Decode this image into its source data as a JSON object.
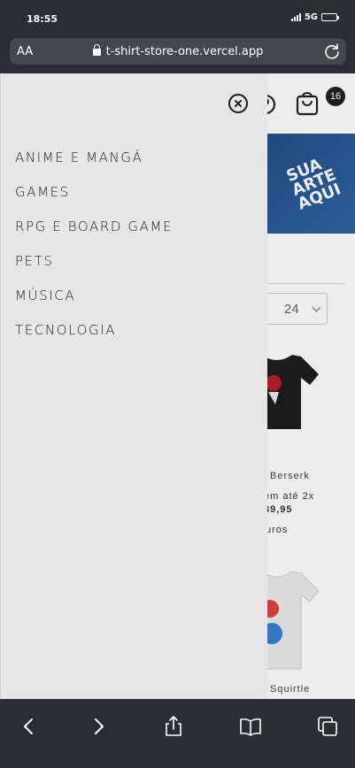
{
  "status_bar": {
    "time": "18:55",
    "network": "5G"
  },
  "browser": {
    "text_size_label": "AA",
    "url": "t-shirt-store-one.vercel.app"
  },
  "page": {
    "cart_count": "16",
    "banner_text": [
      "SUA",
      "ARTE",
      "AQUI"
    ],
    "per_page_value": "24",
    "products": [
      {
        "name": "Berserk",
        "installments": "em até 2x",
        "price": "39,95",
        "extra": "uros"
      },
      {
        "name": "Squirtle"
      }
    ]
  },
  "drawer": {
    "menu_items": [
      {
        "label": "ANIME E MANGÁ"
      },
      {
        "label": "GAMES"
      },
      {
        "label": "RPG E BOARD GAME"
      },
      {
        "label": "PETS"
      },
      {
        "label": "MÚSICA"
      },
      {
        "label": "TECNOLOGIA"
      }
    ]
  },
  "icons": {
    "close": "close-circle-icon",
    "back": "chevron-left-icon",
    "forward": "chevron-right-icon",
    "share": "share-icon",
    "bookmarks": "book-icon",
    "tabs": "tabs-icon",
    "cart": "shopping-bag-icon",
    "lock": "lock-icon",
    "reload": "reload-icon"
  },
  "colors": {
    "drawer_bg": "#e6e6e6",
    "chrome_bg": "#2a2d31",
    "banner": "#23508a"
  }
}
